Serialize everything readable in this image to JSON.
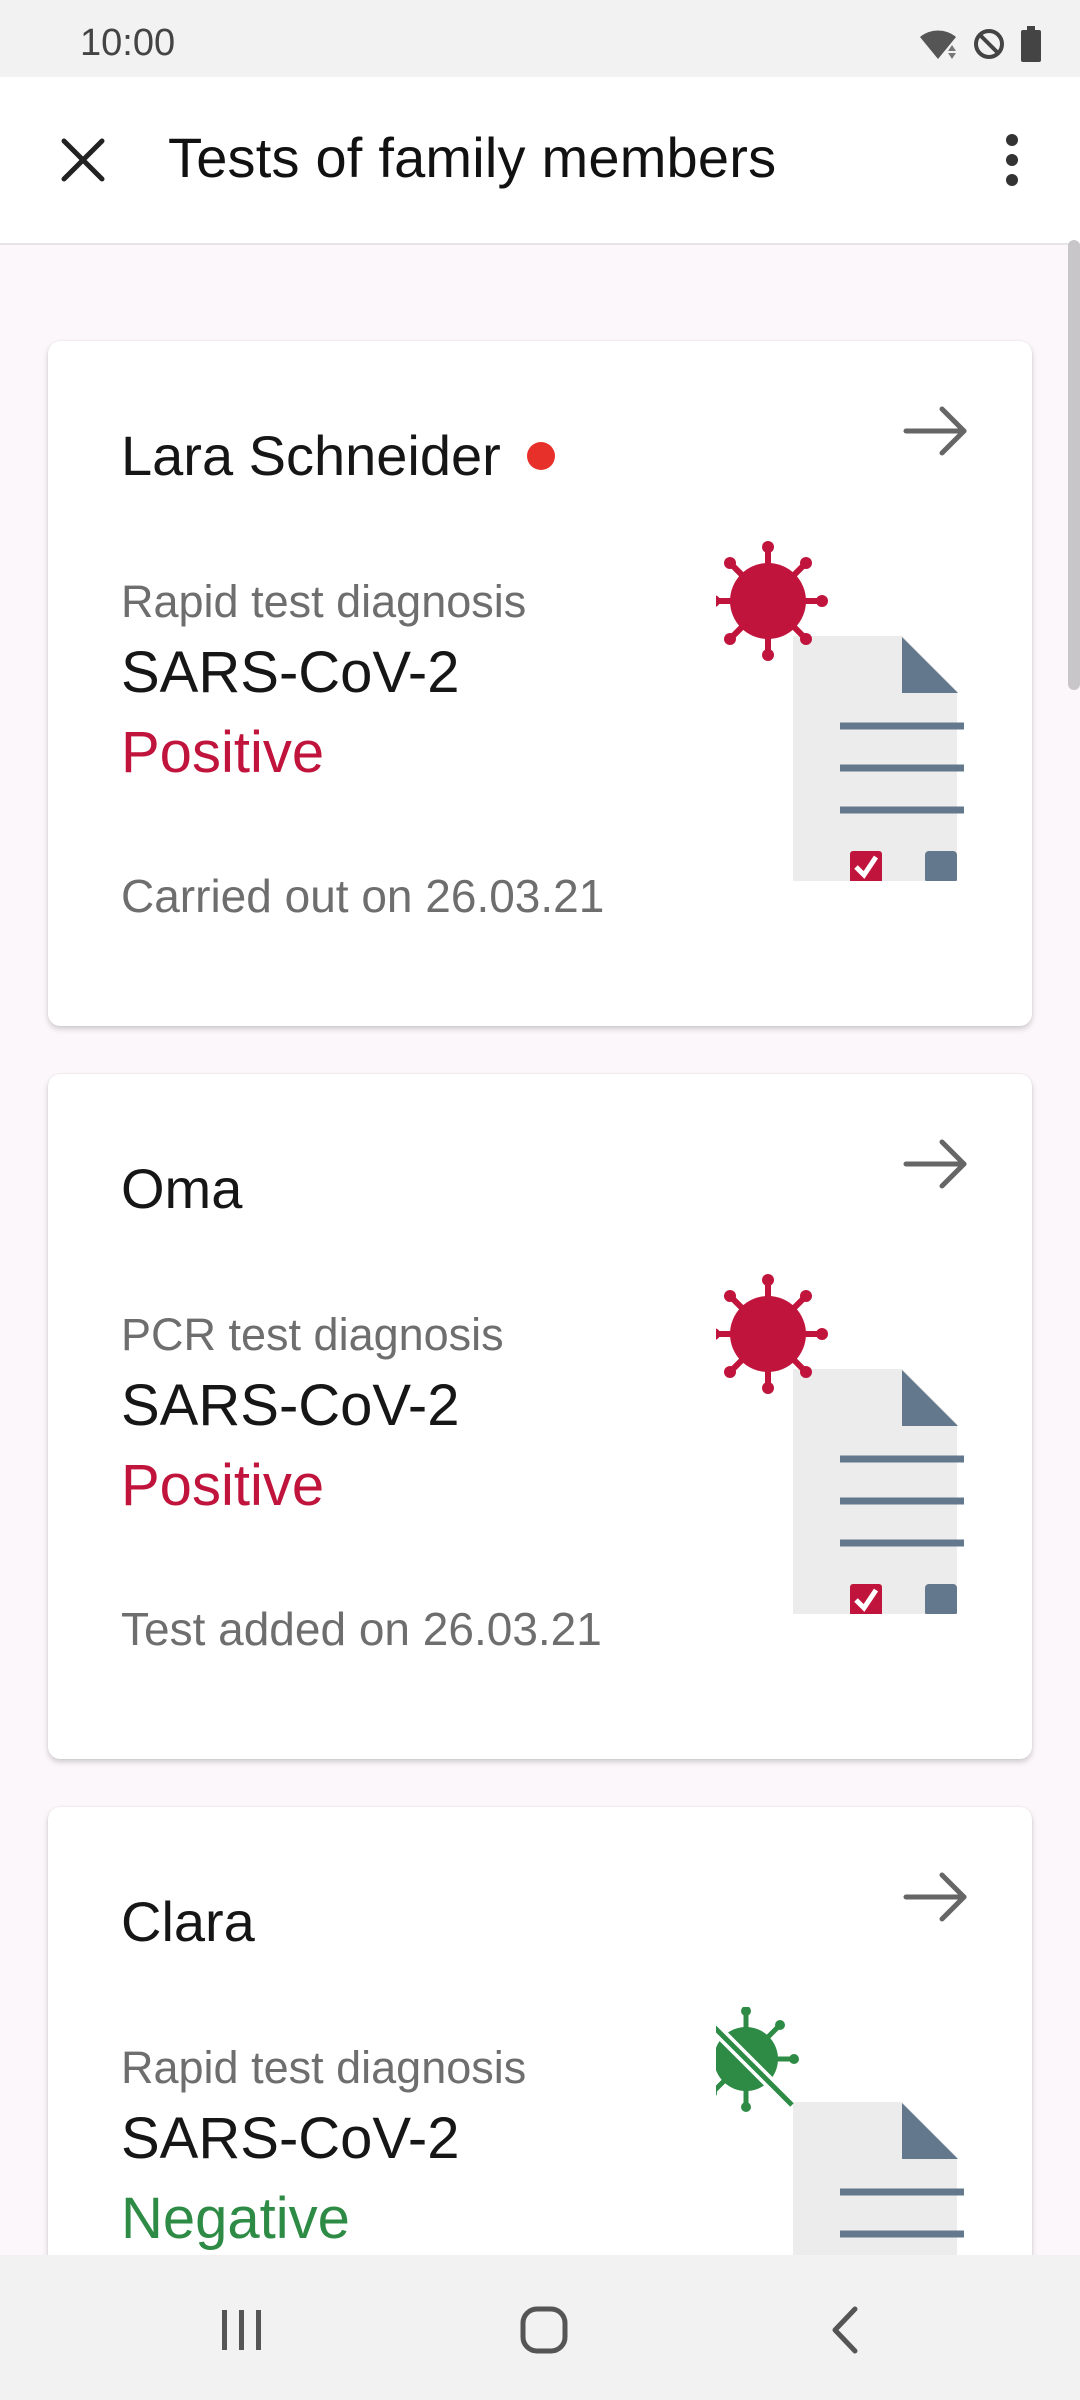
{
  "status_bar": {
    "time": "10:00",
    "icons": [
      "wifi-icon",
      "do-not-disturb-icon",
      "battery-icon"
    ]
  },
  "app_bar": {
    "title": "Tests of family members",
    "close_icon": "close-icon",
    "menu_icon": "more-vert-icon"
  },
  "colors": {
    "positive": "#c0143c",
    "negative": "#2e8b45",
    "unread_dot": "#e8302a",
    "doc_paper": "#ededed",
    "doc_lines": "#63788c"
  },
  "cards": [
    {
      "name": "Lara Schneider",
      "unread": true,
      "diagnosis_label": "Rapid test diagnosis",
      "pathogen": "SARS-CoV-2",
      "result": "Positive",
      "date_text": "Carried out on 26.03.21",
      "illustration": "virus-positive-document-icon"
    },
    {
      "name": "Oma",
      "unread": false,
      "diagnosis_label": "PCR test diagnosis",
      "pathogen": "SARS-CoV-2",
      "result": "Positive",
      "date_text": "Test added on 26.03.21",
      "illustration": "virus-positive-document-icon"
    },
    {
      "name": "Clara",
      "unread": false,
      "diagnosis_label": "Rapid test diagnosis",
      "pathogen": "SARS-CoV-2",
      "result": "Negative",
      "date_text": "",
      "illustration": "virus-negative-document-icon"
    }
  ],
  "nav_bar": {
    "icons": [
      "recent-apps-icon",
      "home-icon",
      "back-icon"
    ]
  }
}
